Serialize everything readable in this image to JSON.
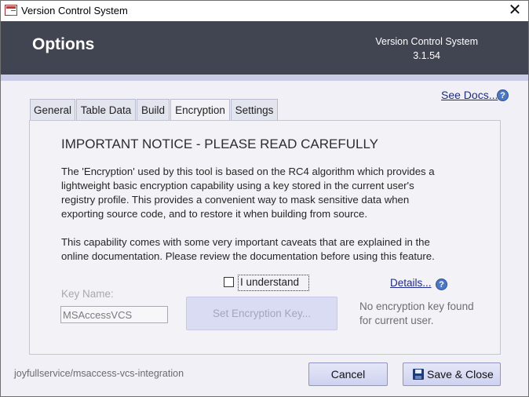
{
  "window": {
    "title": "Version Control System",
    "close_glyph": "✕"
  },
  "header": {
    "title": "Options",
    "app_name": "Version Control System",
    "version": "3.1.54"
  },
  "links": {
    "see_docs": "See Docs...",
    "details": "Details...",
    "help_glyph": "?"
  },
  "tabs": [
    {
      "label": "General",
      "active": false
    },
    {
      "label": "Table Data",
      "active": false
    },
    {
      "label": "Build",
      "active": false
    },
    {
      "label": "Encryption",
      "active": true
    },
    {
      "label": "Settings",
      "active": false
    }
  ],
  "encryption": {
    "notice_title": "IMPORTANT NOTICE - PLEASE READ CAREFULLY",
    "paragraph1": [
      "The 'Encryption' used by this tool is based on the RC4 algorithm which provides a",
      "lightweight basic encryption capability using a key stored in the current user's",
      "registry profile. This provides a convenient way to mask sensitive data when",
      "exporting source code, and to restore it when building from source."
    ],
    "paragraph2": [
      "This capability comes with some very important caveats that are explained in the",
      "online documentation. Please review the documentation before using this feature."
    ],
    "understand_label": "I understand",
    "understand_checked": false,
    "key_name_label": "Key Name:",
    "key_name_value": "MSAccessVCS",
    "set_key_button": "Set Encryption Key...",
    "no_key_status": [
      "No encryption key found",
      "for current user."
    ]
  },
  "footer": {
    "repo_text": "joyfullservice/msaccess-vcs-integration",
    "cancel_label": "Cancel",
    "save_label": "Save & Close"
  },
  "icons": {
    "app": "access-app-icon",
    "help": "help-icon",
    "save": "floppy-disk-icon"
  },
  "colors": {
    "header_bg": "#414551",
    "link": "#1c2a8f",
    "button_bg": "#cfd2f0"
  }
}
